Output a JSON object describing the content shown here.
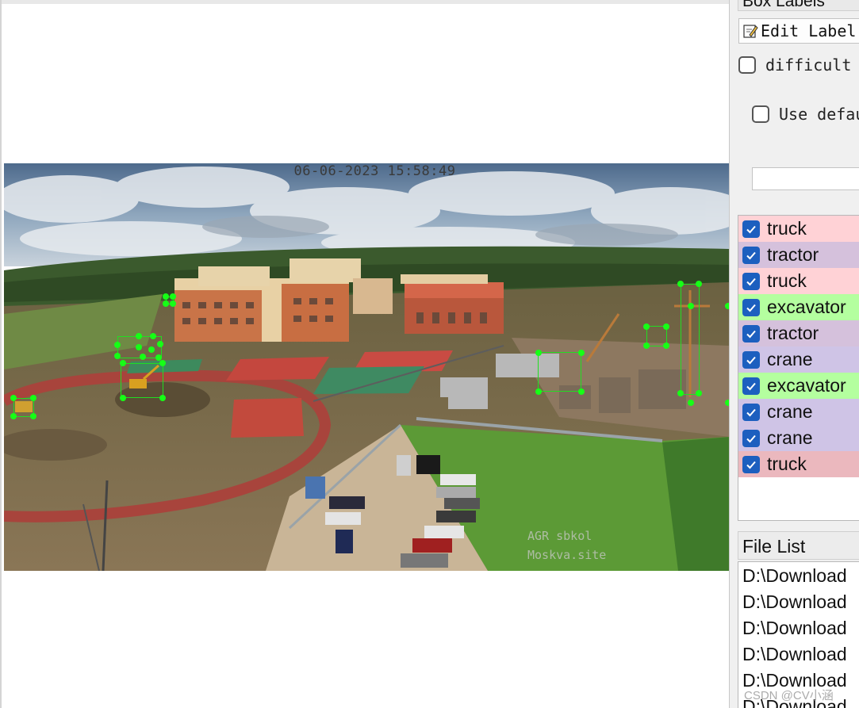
{
  "canvas": {
    "timestamp": "06-06-2023 15:58:49",
    "watermark_line1": "AGR sbkol",
    "watermark_line2": "Moskva.site"
  },
  "dock": {
    "box_labels_title": "Box Labels",
    "edit_label_button": "Edit Label",
    "difficult_label": "difficult",
    "use_default_label": "Use default label",
    "default_label_value": ""
  },
  "labels": [
    {
      "name": "truck",
      "bg": "#ffd2d6",
      "checked": true
    },
    {
      "name": "tractor",
      "bg": "#d5c1dc",
      "checked": true
    },
    {
      "name": "truck",
      "bg": "#ffd2d6",
      "checked": true
    },
    {
      "name": "excavator",
      "bg": "#b4ff9f",
      "checked": true
    },
    {
      "name": "tractor",
      "bg": "#d5c1dc",
      "checked": true
    },
    {
      "name": "crane",
      "bg": "#cfc4e6",
      "checked": true
    },
    {
      "name": "excavator",
      "bg": "#b4ff9f",
      "checked": true
    },
    {
      "name": "crane",
      "bg": "#cfc4e6",
      "checked": true
    },
    {
      "name": "crane",
      "bg": "#cfc4e6",
      "checked": true
    },
    {
      "name": "truck",
      "bg": "#ebb8be",
      "checked": true
    }
  ],
  "file_list": {
    "title": "File List",
    "items": [
      "D:\\Download",
      "D:\\Download",
      "D:\\Download",
      "D:\\Download",
      "D:\\Download",
      "D:\\Download"
    ]
  },
  "csdn_watermark": "CSDN @CV小涵",
  "icons": {
    "edit": "pencil-icon",
    "checked": "check-icon"
  }
}
